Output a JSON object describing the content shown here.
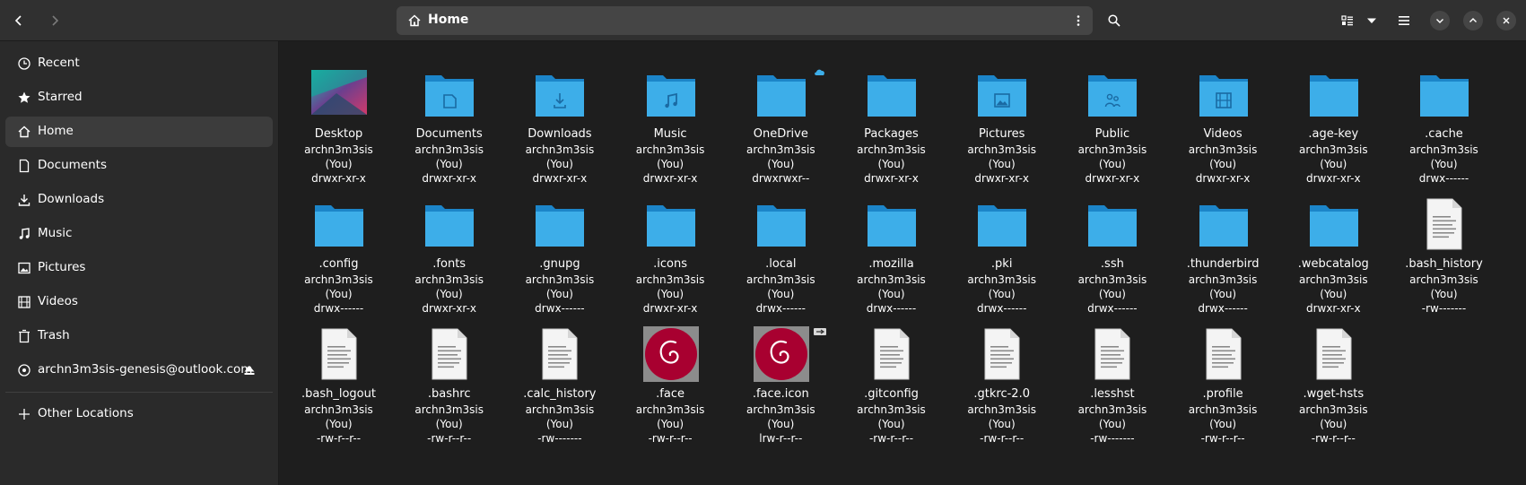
{
  "header": {
    "path_label": "Home",
    "icons": {
      "back": "go-back-icon",
      "forward": "go-forward-icon",
      "home": "home-icon",
      "kebab": "kebab-menu-icon",
      "search": "search-icon",
      "view": "view-list-icon",
      "view_dropdown": "chevron-down-icon",
      "menu": "hamburger-menu-icon",
      "minimize": "minimize-icon",
      "maximize": "maximize-icon",
      "close": "close-icon"
    }
  },
  "sidebar": {
    "items": [
      {
        "label": "Recent",
        "icon": "clock-icon"
      },
      {
        "label": "Starred",
        "icon": "star-icon"
      },
      {
        "label": "Home",
        "icon": "home-icon",
        "active": true
      },
      {
        "label": "Documents",
        "icon": "document-icon"
      },
      {
        "label": "Downloads",
        "icon": "download-icon"
      },
      {
        "label": "Music",
        "icon": "music-icon"
      },
      {
        "label": "Pictures",
        "icon": "picture-icon"
      },
      {
        "label": "Videos",
        "icon": "video-icon"
      },
      {
        "label": "Trash",
        "icon": "trash-icon"
      },
      {
        "label": "archn3m3sis-genesis@outlook.com",
        "icon": "account-icon",
        "eject": true
      }
    ],
    "other_locations": {
      "label": "Other Locations",
      "icon": "plus-icon"
    }
  },
  "files": [
    {
      "name": "Desktop",
      "owner": "archn3m3sis",
      "you": "(You)",
      "perm": "drwxr-xr-x",
      "kind": "desktop"
    },
    {
      "name": "Documents",
      "owner": "archn3m3sis",
      "you": "(You)",
      "perm": "drwxr-xr-x",
      "kind": "folder",
      "glyph": "document"
    },
    {
      "name": "Downloads",
      "owner": "archn3m3sis",
      "you": "(You)",
      "perm": "drwxr-xr-x",
      "kind": "folder",
      "glyph": "download"
    },
    {
      "name": "Music",
      "owner": "archn3m3sis",
      "you": "(You)",
      "perm": "drwxr-xr-x",
      "kind": "folder",
      "glyph": "music"
    },
    {
      "name": "OneDrive",
      "owner": "archn3m3sis",
      "you": "(You)",
      "perm": "drwxrwxr--",
      "kind": "folder",
      "emblem": "cloud"
    },
    {
      "name": "Packages",
      "owner": "archn3m3sis",
      "you": "(You)",
      "perm": "drwxr-xr-x",
      "kind": "folder"
    },
    {
      "name": "Pictures",
      "owner": "archn3m3sis",
      "you": "(You)",
      "perm": "drwxr-xr-x",
      "kind": "folder",
      "glyph": "picture"
    },
    {
      "name": "Public",
      "owner": "archn3m3sis",
      "you": "(You)",
      "perm": "drwxr-xr-x",
      "kind": "folder",
      "glyph": "people"
    },
    {
      "name": "Videos",
      "owner": "archn3m3sis",
      "you": "(You)",
      "perm": "drwxr-xr-x",
      "kind": "folder",
      "glyph": "video"
    },
    {
      "name": ".age-key",
      "owner": "archn3m3sis",
      "you": "(You)",
      "perm": "drwxr-xr-x",
      "kind": "folder"
    },
    {
      "name": ".cache",
      "owner": "archn3m3sis",
      "you": "(You)",
      "perm": "drwx------",
      "kind": "folder"
    },
    {
      "name": ".config",
      "owner": "archn3m3sis",
      "you": "(You)",
      "perm": "drwx------",
      "kind": "folder"
    },
    {
      "name": ".fonts",
      "owner": "archn3m3sis",
      "you": "(You)",
      "perm": "drwxr-xr-x",
      "kind": "folder"
    },
    {
      "name": ".gnupg",
      "owner": "archn3m3sis",
      "you": "(You)",
      "perm": "drwx------",
      "kind": "folder"
    },
    {
      "name": ".icons",
      "owner": "archn3m3sis",
      "you": "(You)",
      "perm": "drwxr-xr-x",
      "kind": "folder"
    },
    {
      "name": ".local",
      "owner": "archn3m3sis",
      "you": "(You)",
      "perm": "drwx------",
      "kind": "folder"
    },
    {
      "name": ".mozilla",
      "owner": "archn3m3sis",
      "you": "(You)",
      "perm": "drwx------",
      "kind": "folder"
    },
    {
      "name": ".pki",
      "owner": "archn3m3sis",
      "you": "(You)",
      "perm": "drwx------",
      "kind": "folder"
    },
    {
      "name": ".ssh",
      "owner": "archn3m3sis",
      "you": "(You)",
      "perm": "drwx------",
      "kind": "folder"
    },
    {
      "name": ".thunderbird",
      "owner": "archn3m3sis",
      "you": "(You)",
      "perm": "drwx------",
      "kind": "folder"
    },
    {
      "name": ".webcatalog",
      "owner": "archn3m3sis",
      "you": "(You)",
      "perm": "drwxr-xr-x",
      "kind": "folder"
    },
    {
      "name": ".bash_history",
      "owner": "archn3m3sis",
      "you": "(You)",
      "perm": "-rw-------",
      "kind": "text"
    },
    {
      "name": ".bash_logout",
      "owner": "archn3m3sis",
      "you": "(You)",
      "perm": "-rw-r--r--",
      "kind": "text"
    },
    {
      "name": ".bashrc",
      "owner": "archn3m3sis",
      "you": "(You)",
      "perm": "-rw-r--r--",
      "kind": "text"
    },
    {
      "name": ".calc_history",
      "owner": "archn3m3sis",
      "you": "(You)",
      "perm": "-rw-------",
      "kind": "text"
    },
    {
      "name": ".face",
      "owner": "archn3m3sis",
      "you": "(You)",
      "perm": "-rw-r--r--",
      "kind": "image"
    },
    {
      "name": ".face.icon",
      "owner": "archn3m3sis",
      "you": "(You)",
      "perm": "lrw-r--r--",
      "kind": "image",
      "emblem": "link"
    },
    {
      "name": ".gitconfig",
      "owner": "archn3m3sis",
      "you": "(You)",
      "perm": "-rw-r--r--",
      "kind": "text"
    },
    {
      "name": ".gtkrc-2.0",
      "owner": "archn3m3sis",
      "you": "(You)",
      "perm": "-rw-r--r--",
      "kind": "text"
    },
    {
      "name": ".lesshst",
      "owner": "archn3m3sis",
      "you": "(You)",
      "perm": "-rw-------",
      "kind": "text"
    },
    {
      "name": ".profile",
      "owner": "archn3m3sis",
      "you": "(You)",
      "perm": "-rw-r--r--",
      "kind": "text"
    },
    {
      "name": ".wget-hsts",
      "owner": "archn3m3sis",
      "you": "(You)",
      "perm": "-rw-r--r--",
      "kind": "text"
    }
  ],
  "colors": {
    "folder_back": "#1c85c9",
    "folder_front": "#3daee9",
    "folder_glyph": "#1a6aa3",
    "debian_red": "#a80030"
  }
}
